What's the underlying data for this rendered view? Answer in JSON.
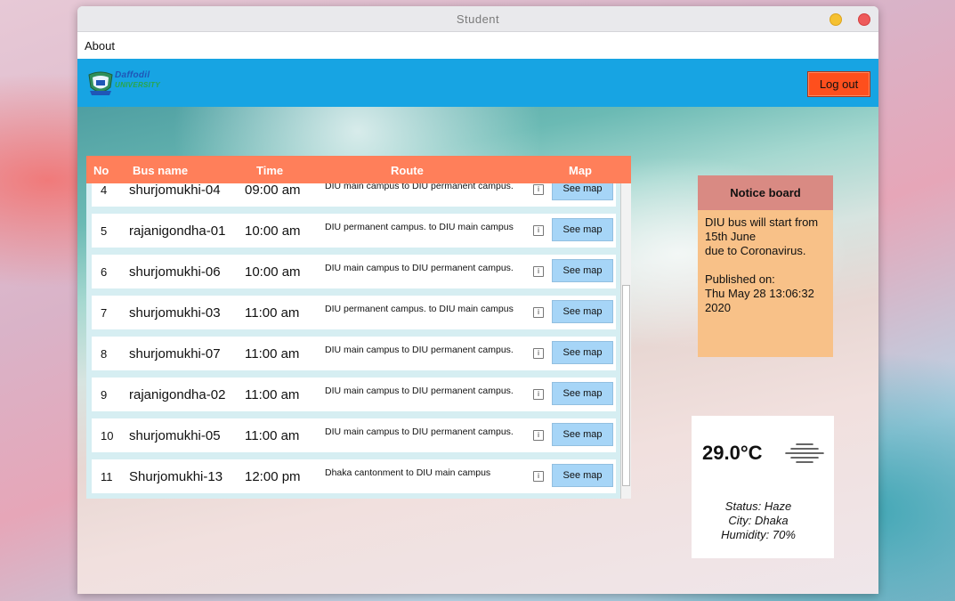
{
  "window": {
    "title": "Student"
  },
  "menu": {
    "items": [
      "About"
    ]
  },
  "header": {
    "logo_line1": "Daffodil",
    "logo_line2": "UNIVERSITY",
    "logout_label": "Log out"
  },
  "table": {
    "columns": [
      "No",
      "Bus name",
      "Time",
      "Route",
      "Map"
    ],
    "rows": [
      {
        "no": "4",
        "name": "shurjomukhi-04",
        "time": "09:00 am",
        "route": "DIU main campus to DIU permanent campus.",
        "map": "See map"
      },
      {
        "no": "5",
        "name": "rajanigondha-01",
        "time": "10:00 am",
        "route": "DIU permanent campus. to DIU main campus",
        "map": "See map"
      },
      {
        "no": "6",
        "name": "shurjomukhi-06",
        "time": "10:00 am",
        "route": "DIU main campus to DIU permanent campus.",
        "map": "See map"
      },
      {
        "no": "7",
        "name": "shurjomukhi-03",
        "time": "11:00 am",
        "route": "DIU permanent campus. to DIU main campus",
        "map": "See map"
      },
      {
        "no": "8",
        "name": "shurjomukhi-07",
        "time": "11:00 am",
        "route": "DIU main campus to DIU permanent campus.",
        "map": "See map"
      },
      {
        "no": "9",
        "name": "rajanigondha-02",
        "time": "11:00 am",
        "route": "DIU main campus to DIU permanent campus.",
        "map": "See map"
      },
      {
        "no": "10",
        "name": "shurjomukhi-05",
        "time": "11:00 am",
        "route": "DIU main campus to DIU permanent campus.",
        "map": "See map"
      },
      {
        "no": "11",
        "name": "Shurjomukhi-13",
        "time": "12:00 pm",
        "route": "Dhaka cantonment to DIU main campus",
        "map": "See map"
      }
    ]
  },
  "notice": {
    "title": "Notice board",
    "body": "DIU bus will start from 15th June\ndue to Coronavirus.\n\nPublished on:\nThu May 28 13:06:32 2020"
  },
  "weather": {
    "temperature": "29.0°C",
    "icon": "haze-icon",
    "status": "Status: Haze",
    "city": "City: Dhaka",
    "humidity": "Humidity: 70%"
  },
  "colors": {
    "header_bg": "#17a4e3",
    "logout_bg": "#fe4f1d",
    "table_header_bg": "#ff7f5a",
    "map_button_bg": "#a6d5f7",
    "notice_head_bg": "#d98a83",
    "notice_body_bg": "#f8c188"
  }
}
